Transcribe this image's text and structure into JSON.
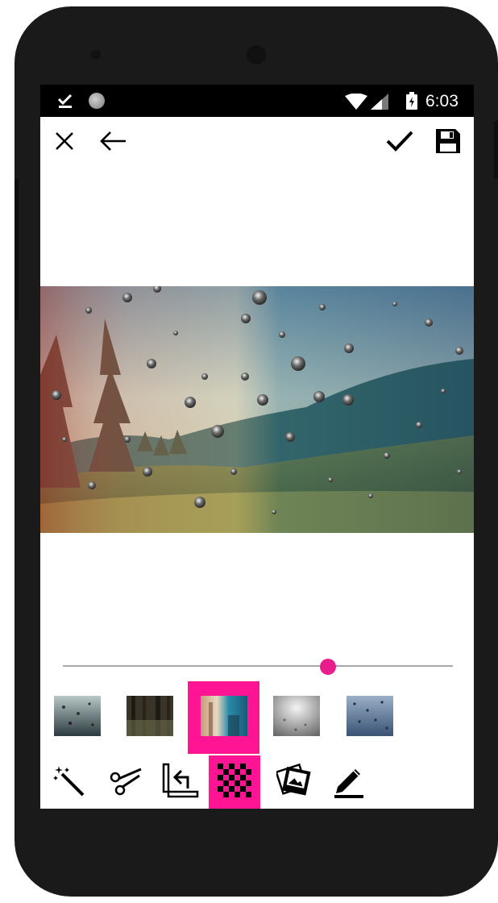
{
  "status_bar": {
    "time": "6:03",
    "icons": [
      "download-done-icon",
      "notification-dot-icon",
      "wifi-icon",
      "cell-signal-icon",
      "battery-charging-icon"
    ]
  },
  "toolbar": {
    "icons": [
      "close-icon",
      "back-arrow-icon",
      "check-icon",
      "save-icon"
    ]
  },
  "editor": {
    "opacity_slider": {
      "value": 0.68
    }
  },
  "overlays": {
    "selected_index": 2,
    "items": [
      "rain-overlay-1",
      "rain-overlay-2",
      "rain-overlay-3",
      "rain-overlay-4",
      "rain-overlay-5"
    ]
  },
  "tools": {
    "selected_index": 3,
    "items": [
      "magic-wand-icon",
      "scissors-icon",
      "undo-layer-icon",
      "checkerboard-icon",
      "photos-icon",
      "pencil-icon"
    ]
  },
  "colors": {
    "accent": "#e91e8c",
    "selection": "#ff1493",
    "status_bar": "#000000",
    "device": "#1a1a1a"
  }
}
